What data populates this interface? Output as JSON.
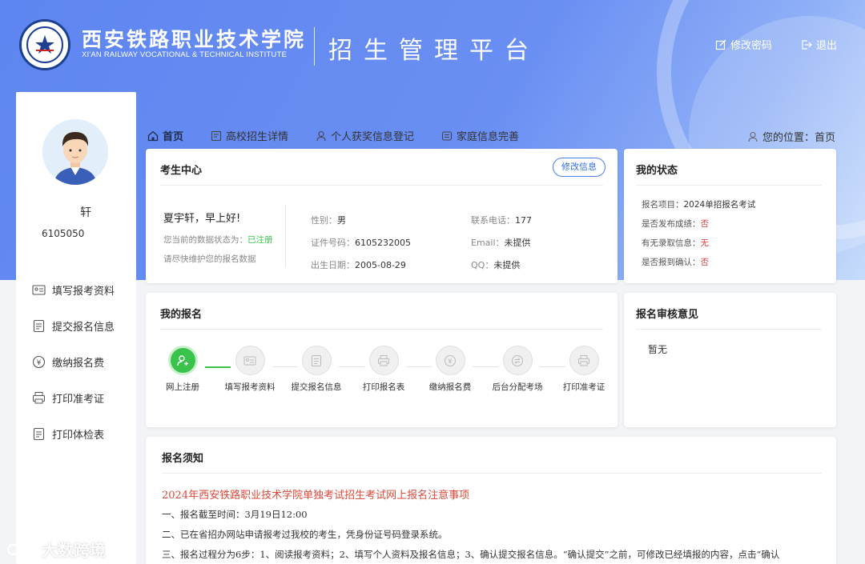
{
  "header": {
    "school_cn": "西安铁路职业技术学院",
    "school_en": "XI'AN RAILWAY VOCATIONAL & TECHNICAL INSTITUTE",
    "platform": "招生管理平台",
    "change_password": "修改密码",
    "logout": "退出"
  },
  "sidebar": {
    "name": "轩",
    "id": "6105050",
    "items": [
      {
        "label": "填写报考资料",
        "icon": "id-card-icon"
      },
      {
        "label": "提交报名信息",
        "icon": "document-icon"
      },
      {
        "label": "缴纳报名费",
        "icon": "yen-icon"
      },
      {
        "label": "打印准考证",
        "icon": "printer-icon"
      },
      {
        "label": "打印体检表",
        "icon": "document-icon"
      }
    ]
  },
  "tabs": [
    {
      "label": "首页",
      "icon": "home-icon"
    },
    {
      "label": "高校招生详情",
      "icon": "list-icon"
    },
    {
      "label": "个人获奖信息登记",
      "icon": "user-icon"
    },
    {
      "label": "家庭信息完善",
      "icon": "family-icon"
    }
  ],
  "location": "您的位置：首页",
  "candidate": {
    "title": "考生中心",
    "edit_button": "修改信息",
    "greeting": "夏宇轩，早上好!",
    "status_prefix": "您当前的数据状态为：",
    "status_value": "已注册",
    "reminder": "请尽快维护您的报名数据",
    "gender_k": "性别：",
    "gender_v": "男",
    "idno_k": "证件号码：",
    "idno_v": "6105232005",
    "birth_k": "出生日期：",
    "birth_v": "2005-08-29",
    "phone_k": "联系电话：",
    "phone_v": "177",
    "email_k": "Email：",
    "email_v": "未提供",
    "qq_k": "QQ：",
    "qq_v": "未提供"
  },
  "my_status": {
    "title": "我的状态",
    "project_k": "报名项目：",
    "project_v": "2024单招报名考试",
    "score_k": "是否发布成绩：",
    "score_v": "否",
    "admit_k": "有无录取信息：",
    "admit_v": "无",
    "report_k": "是否报到确认：",
    "report_v": "否"
  },
  "my_registration": {
    "title": "我的报名",
    "steps": [
      {
        "label": "网上注册",
        "done": true
      },
      {
        "label": "填写报考资料",
        "done": false
      },
      {
        "label": "提交报名信息",
        "done": false
      },
      {
        "label": "打印报名表",
        "done": false
      },
      {
        "label": "缴纳报名费",
        "done": false
      },
      {
        "label": "后台分配考场",
        "done": false
      },
      {
        "label": "打印准考证",
        "done": false
      }
    ]
  },
  "review": {
    "title": "报名审核意见",
    "text": "暂无"
  },
  "notice": {
    "title": "报名须知",
    "headline": "2024年西安铁路职业技术学院单独考试招生考试网上报名注意事项",
    "lines": [
      "一、报名截至时间：3月19日12:00",
      "二、已在省招办网站申请报考过我校的考生，凭身份证号码登录系统。",
      "三、报名过程分为6步：1、阅读报考资料；2、填写个人资料及报名信息；3、确认提交报名信息。“确认提交”之前，可修改已经填报的内容，点击“确认"
    ]
  },
  "watermark": "大数跨境",
  "colors": {
    "accent": "#2f6fe8",
    "success": "#3ac34a",
    "danger": "#e23b3b",
    "banner": "#6a8ff3"
  }
}
